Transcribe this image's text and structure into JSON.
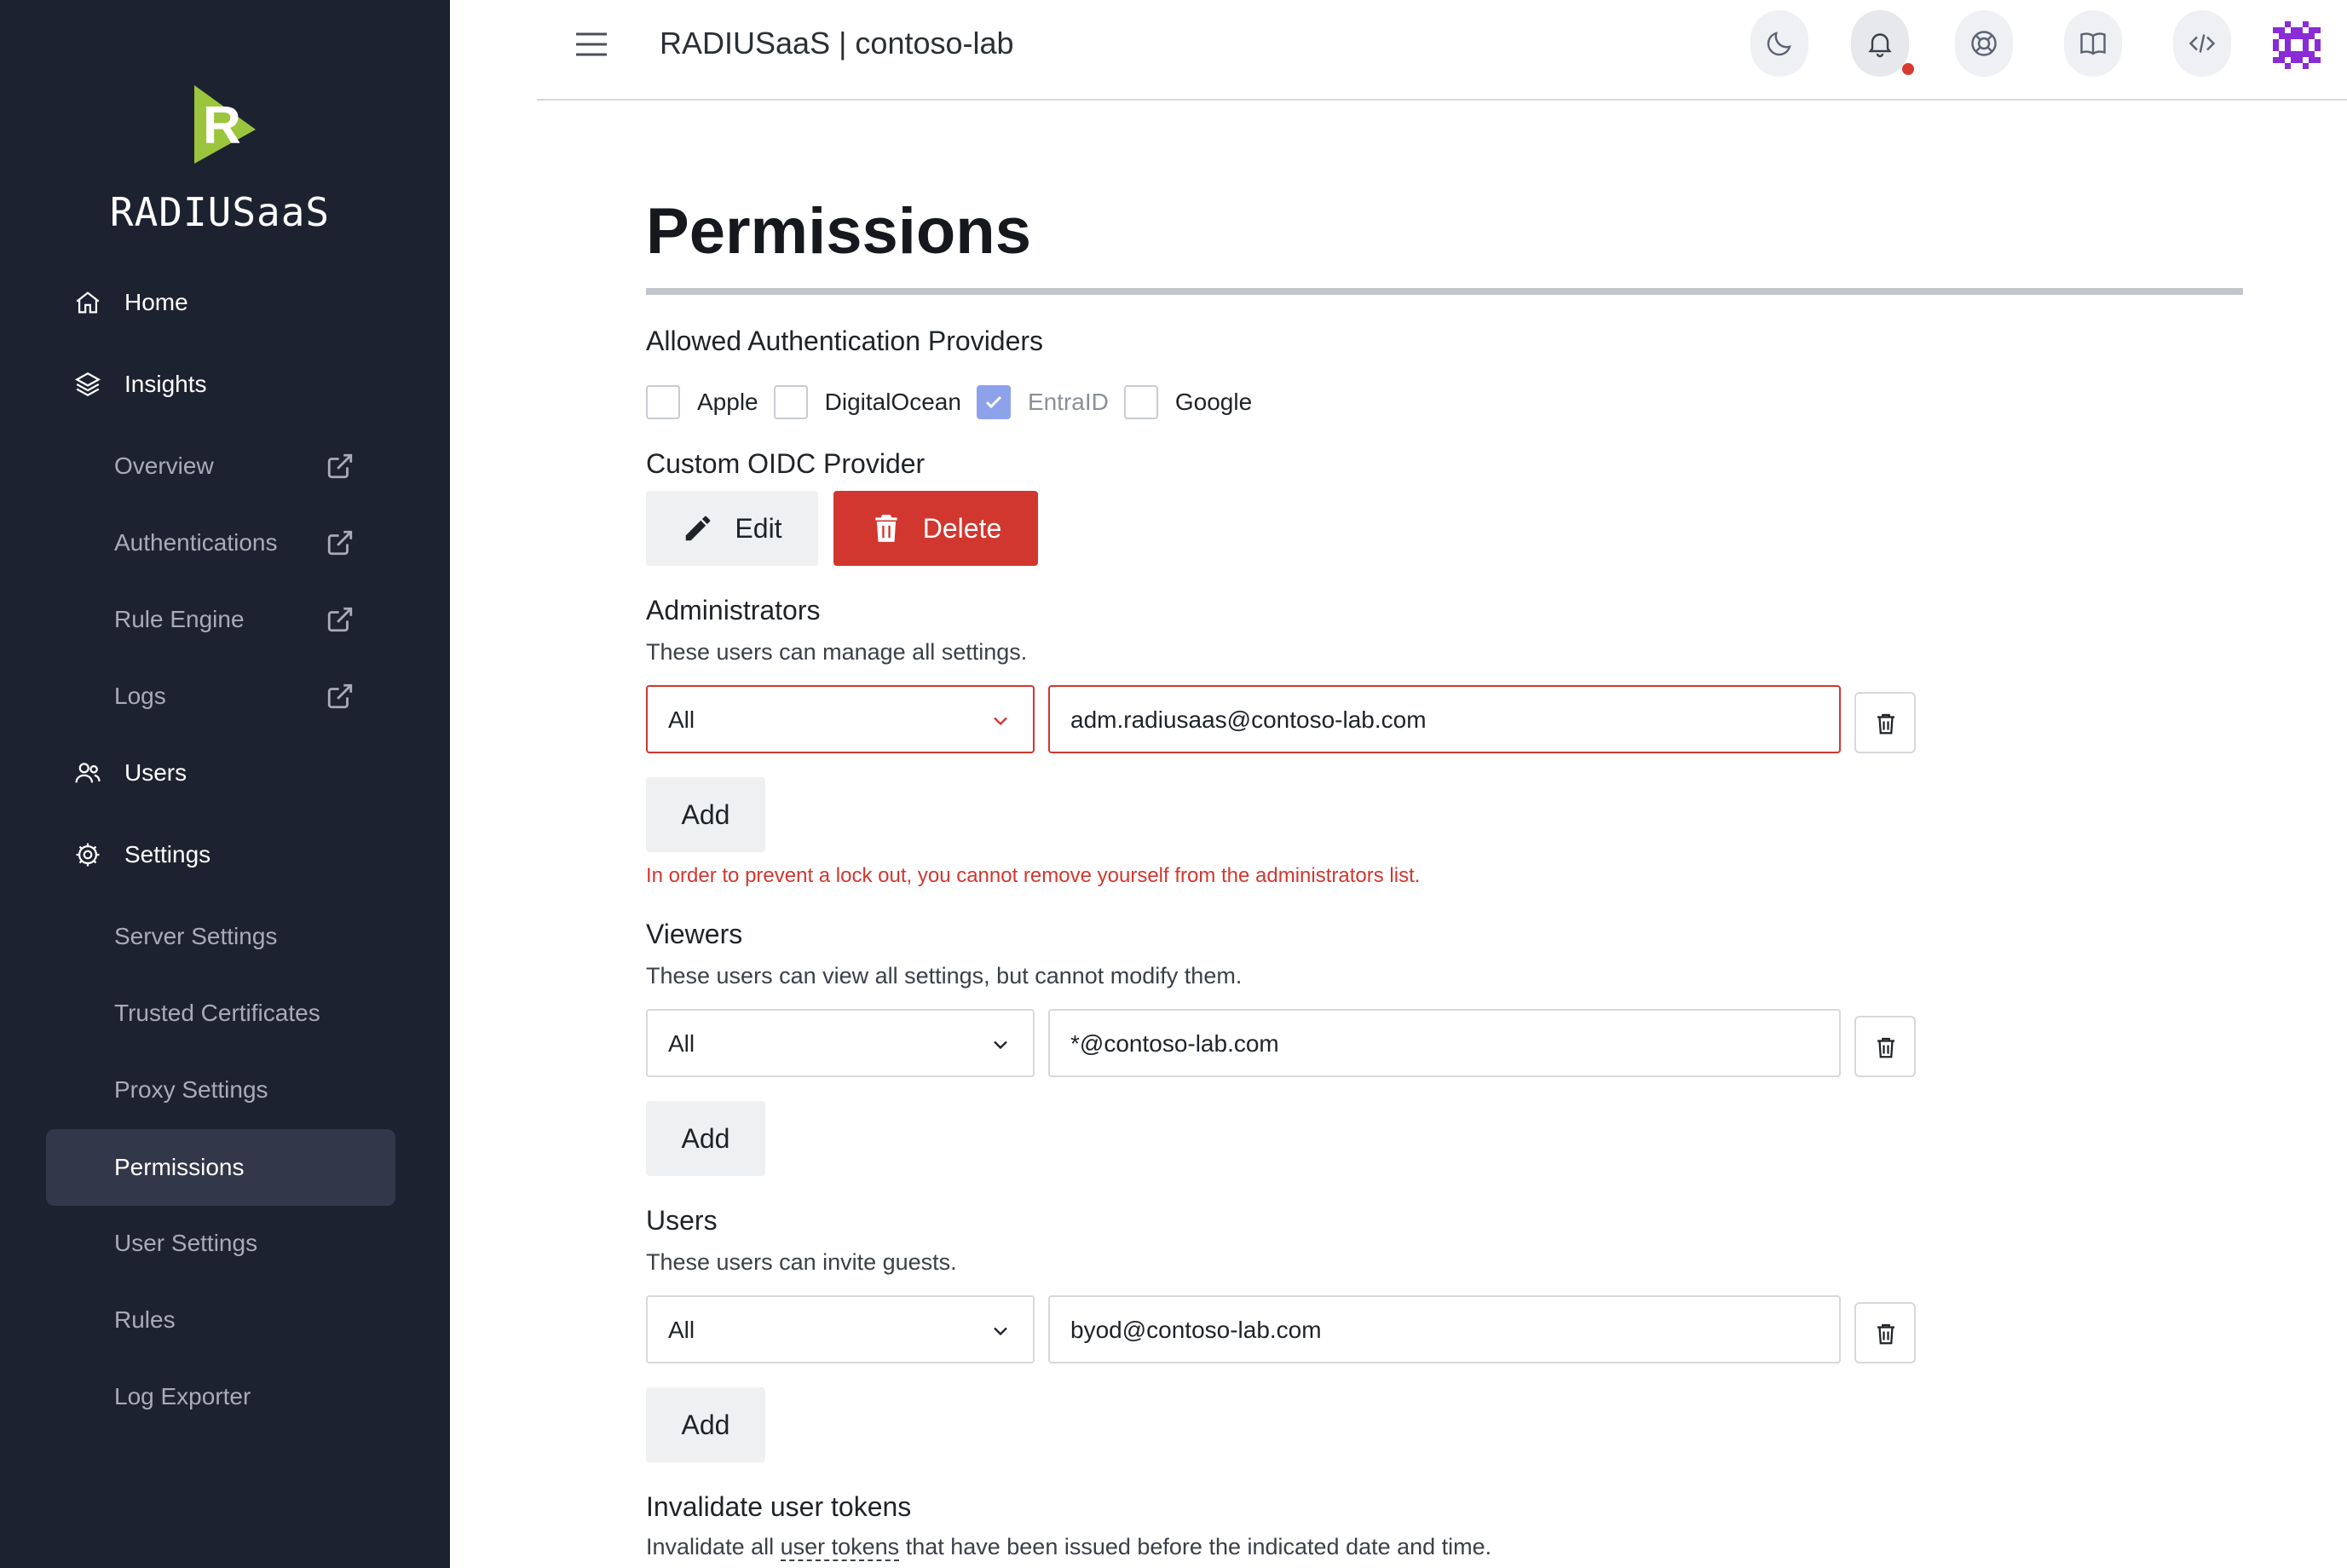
{
  "app": {
    "brand": "RADIUSaaS",
    "title": "RADIUSaaS | contoso-lab"
  },
  "colors": {
    "sidebar_bg": "#1d2230",
    "sidebar_active": "#323849",
    "logo_green": "#9bc53d",
    "danger": "#d1372f",
    "checkbox_checked": "#8da2ea"
  },
  "sidebar": {
    "home": {
      "label": "Home",
      "icon": "home-icon"
    },
    "insights": {
      "label": "Insights",
      "icon": "layers-icon"
    },
    "insights_items": [
      {
        "label": "Overview",
        "icon": "external-link-icon"
      },
      {
        "label": "Authentications",
        "icon": "external-link-icon"
      },
      {
        "label": "Rule Engine",
        "icon": "external-link-icon"
      },
      {
        "label": "Logs",
        "icon": "external-link-icon"
      }
    ],
    "users": {
      "label": "Users",
      "icon": "users-icon"
    },
    "settings": {
      "label": "Settings",
      "icon": "gear-icon"
    },
    "settings_items": [
      {
        "label": "Server Settings"
      },
      {
        "label": "Trusted Certificates"
      },
      {
        "label": "Proxy Settings"
      },
      {
        "label": "Permissions",
        "active": true
      },
      {
        "label": "User Settings"
      },
      {
        "label": "Rules"
      },
      {
        "label": "Log Exporter"
      }
    ]
  },
  "header_icons": [
    "menu-icon",
    "moon-icon",
    "bell-icon",
    "lifebuoy-icon",
    "book-icon",
    "code-icon",
    "avatar"
  ],
  "page": {
    "title": "Permissions",
    "auth_providers": {
      "title": "Allowed Authentication Providers",
      "options": [
        {
          "label": "Apple",
          "checked": false
        },
        {
          "label": "DigitalOcean",
          "checked": false
        },
        {
          "label": "EntraID",
          "checked": true
        },
        {
          "label": "Google",
          "checked": false
        }
      ]
    },
    "custom_oidc": {
      "title": "Custom OIDC Provider",
      "edit_label": "Edit",
      "delete_label": "Delete"
    },
    "administrators": {
      "title": "Administrators",
      "description": "These users can manage all settings.",
      "select_value": "All",
      "email": "adm.radiusaas@contoso-lab.com",
      "add_label": "Add",
      "error": "In order to prevent a lock out, you cannot remove yourself from the administrators list."
    },
    "viewers": {
      "title": "Viewers",
      "description": "These users can view all settings, but cannot modify them.",
      "select_value": "All",
      "email": "*@contoso-lab.com",
      "add_label": "Add"
    },
    "users": {
      "title": "Users",
      "description": "These users can invite guests.",
      "select_value": "All",
      "email": "byod@contoso-lab.com",
      "add_label": "Add"
    },
    "invalidate": {
      "title": "Invalidate user tokens",
      "desc_before": "Invalidate all ",
      "desc_link": "user tokens",
      "desc_after": " that have been issued before the indicated date and time."
    }
  }
}
